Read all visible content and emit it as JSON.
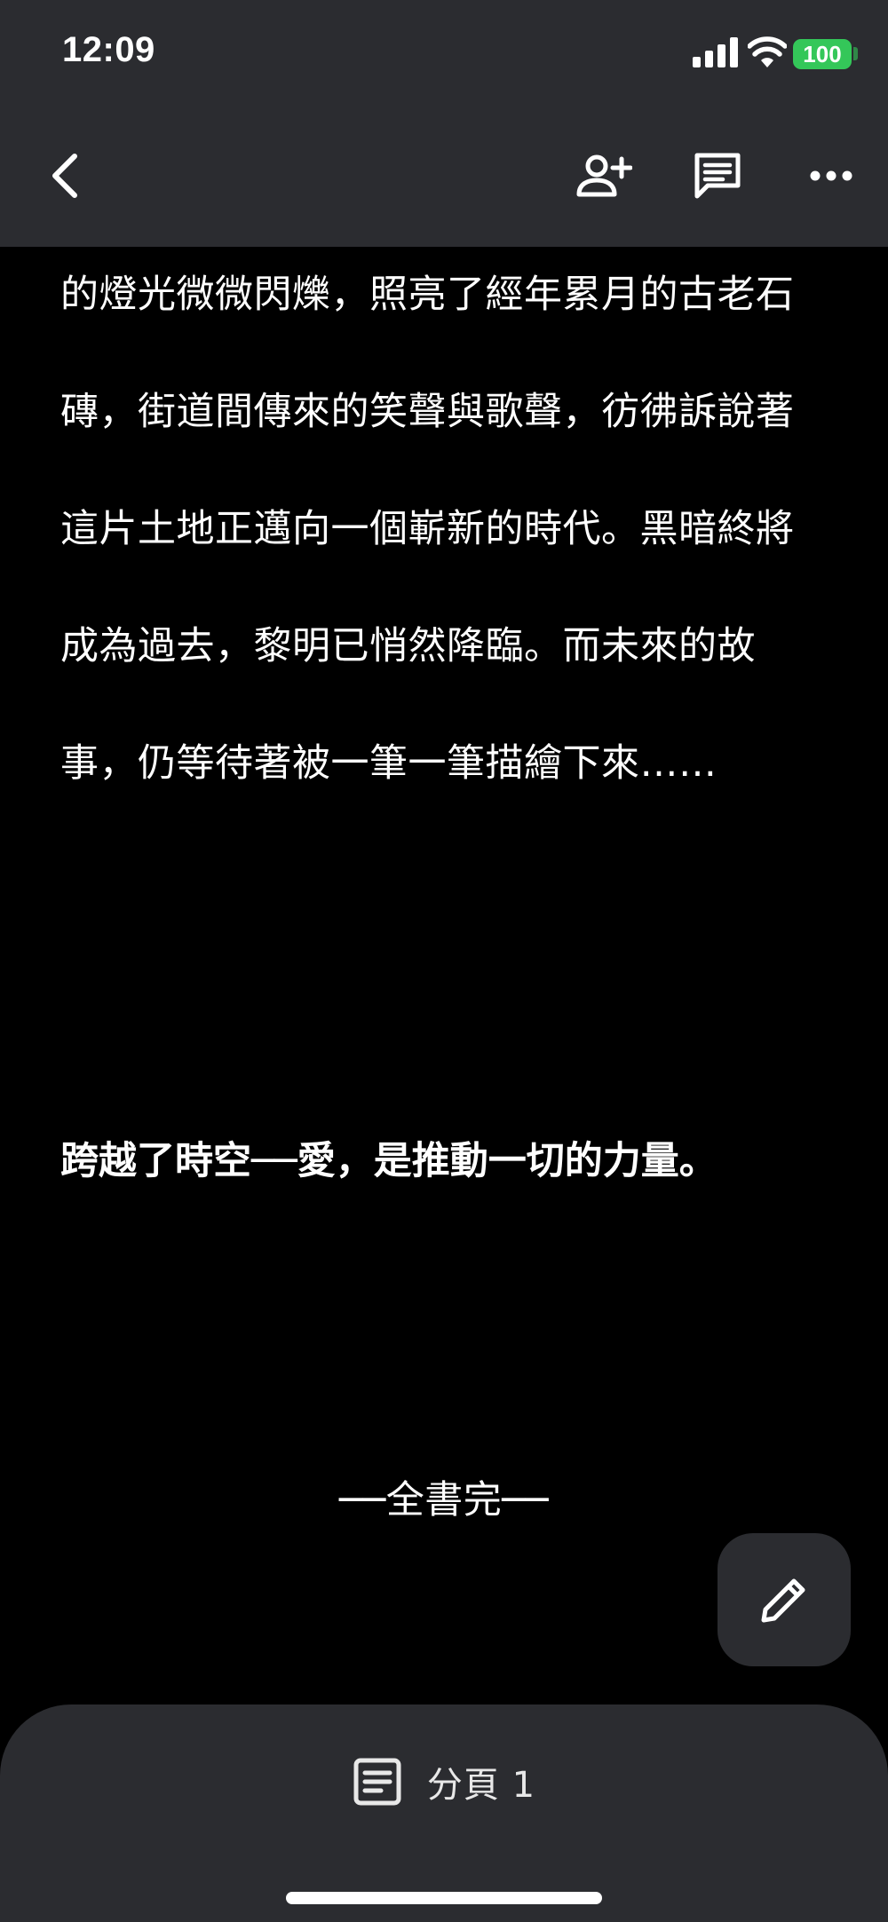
{
  "status_bar": {
    "time": "12:09",
    "battery_level": "100",
    "icons": [
      "cellular-signal-icon",
      "wifi-icon",
      "battery-icon"
    ]
  },
  "app_bar": {
    "icons": [
      "back-arrow-icon",
      "add-person-icon",
      "comment-icon",
      "more-options-icon"
    ]
  },
  "document": {
    "main_paragraph": "的燈光微微閃爍，照亮了經年累月的古老石磚，街道間傳來的笑聲與歌聲，彷彿訴說著這片土地正邁向一個嶄新的時代。黑暗終將成為過去，黎明已悄然降臨。而未來的故事，仍等待著被一筆一筆描繪下來……",
    "bold_line": "跨越了時空──愛，是推動一切的力量。",
    "end_mark": "──全書完──"
  },
  "fab": {
    "icon": "pencil-icon"
  },
  "bottom_sheet": {
    "page_icon": "page-icon",
    "page_label": "分頁 1"
  },
  "colors": {
    "background": "#000000",
    "bar_background": "#2b2c30",
    "text": "#ffffff",
    "battery": "#34c759"
  }
}
